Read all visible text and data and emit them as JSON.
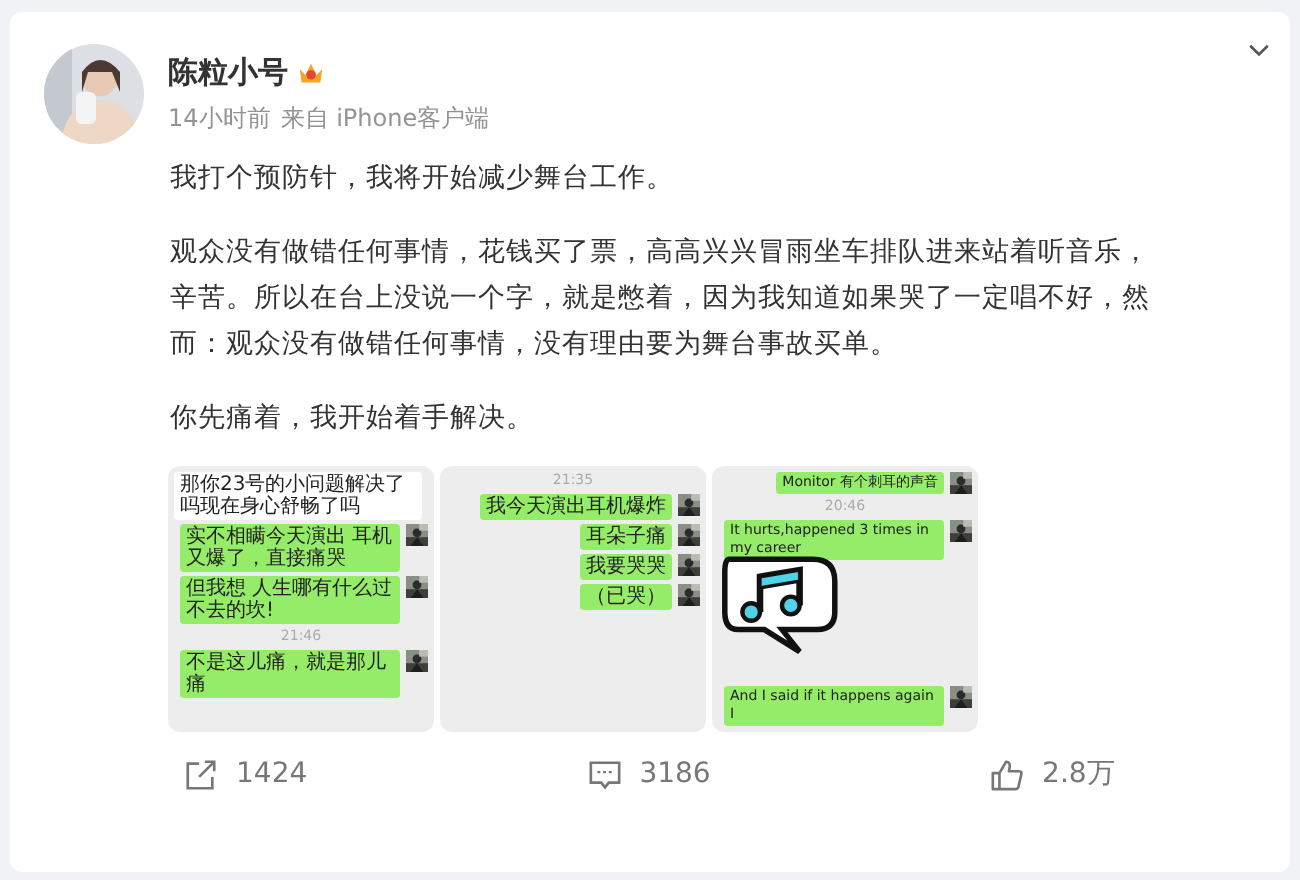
{
  "post": {
    "author": "陈粒小号",
    "time": "14小时前",
    "source": "来自 iPhone客户端"
  },
  "paragraphs": [
    "我打个预防针，我将开始减少舞台工作。",
    "观众没有做错任何事情，花钱买了票，高高兴兴冒雨坐车排队进来站着听音乐，辛苦。所以在台上没说一个字，就是憋着，因为我知道如果哭了一定唱不好，然而：观众没有做错任何事情，没有理由要为舞台事故买单。",
    "你先痛着，我开始着手解决。"
  ],
  "images": [
    {
      "sticker": false,
      "messages": [
        {
          "kind": "received",
          "text": "那你23号的小问题解决了吗现在身心舒畅了吗"
        },
        {
          "kind": "sent",
          "text": "实不相瞒今天演出 耳机又爆了，直接痛哭"
        },
        {
          "kind": "sent",
          "text": "但我想 人生哪有什么过不去的坎!"
        },
        {
          "kind": "time",
          "text": "21:46"
        },
        {
          "kind": "sent",
          "text": "不是这儿痛，就是那儿痛"
        }
      ]
    },
    {
      "sticker": false,
      "messages": [
        {
          "kind": "time",
          "text": "21:35"
        },
        {
          "kind": "sent",
          "text": "我今天演出耳机爆炸"
        },
        {
          "kind": "sent",
          "text": "耳朵子痛"
        },
        {
          "kind": "sent",
          "text": "我要哭哭"
        },
        {
          "kind": "sent",
          "text": "（已哭）"
        }
      ]
    },
    {
      "sticker": true,
      "messages": [
        {
          "kind": "sent",
          "text": "Monitor 有个刺耳的声音"
        },
        {
          "kind": "time",
          "text": "20:46"
        },
        {
          "kind": "sent",
          "text": "It hurts,happened 3 times in my career"
        },
        {
          "kind": "sent",
          "text": "And I said if it happens again I"
        }
      ]
    }
  ],
  "actions": [
    {
      "kind": "repost",
      "count": "1424"
    },
    {
      "kind": "comment",
      "count": "3186"
    },
    {
      "kind": "like",
      "count": "2.8万"
    }
  ]
}
